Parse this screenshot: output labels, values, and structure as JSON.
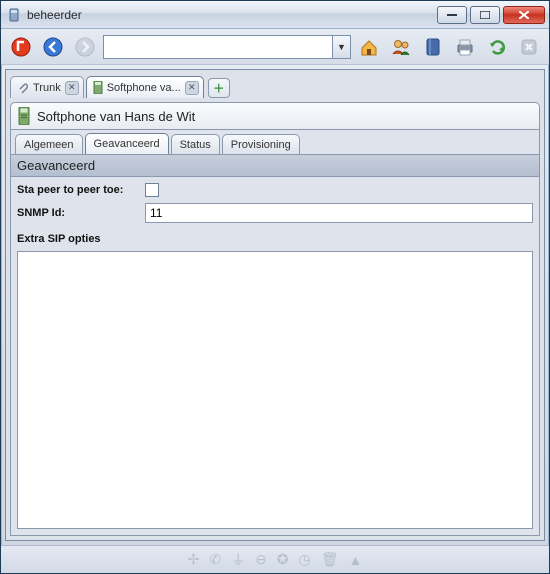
{
  "window": {
    "title": "beheerder"
  },
  "toolbar": {
    "address_value": ""
  },
  "file_tabs": [
    {
      "label": "Trunk",
      "active": false
    },
    {
      "label": "Softphone va...",
      "active": true
    }
  ],
  "page": {
    "title": "Softphone van Hans de Wit"
  },
  "section_tabs": [
    {
      "label": "Algemeen",
      "active": false
    },
    {
      "label": "Geavanceerd",
      "active": true
    },
    {
      "label": "Status",
      "active": false
    },
    {
      "label": "Provisioning",
      "active": false
    }
  ],
  "panel": {
    "heading": "Geavanceerd",
    "peer_label": "Sta peer to peer toe:",
    "peer_checked": false,
    "snmp_label": "SNMP Id:",
    "snmp_value": "11",
    "extra_label": "Extra SIP opties",
    "extra_value": ""
  }
}
